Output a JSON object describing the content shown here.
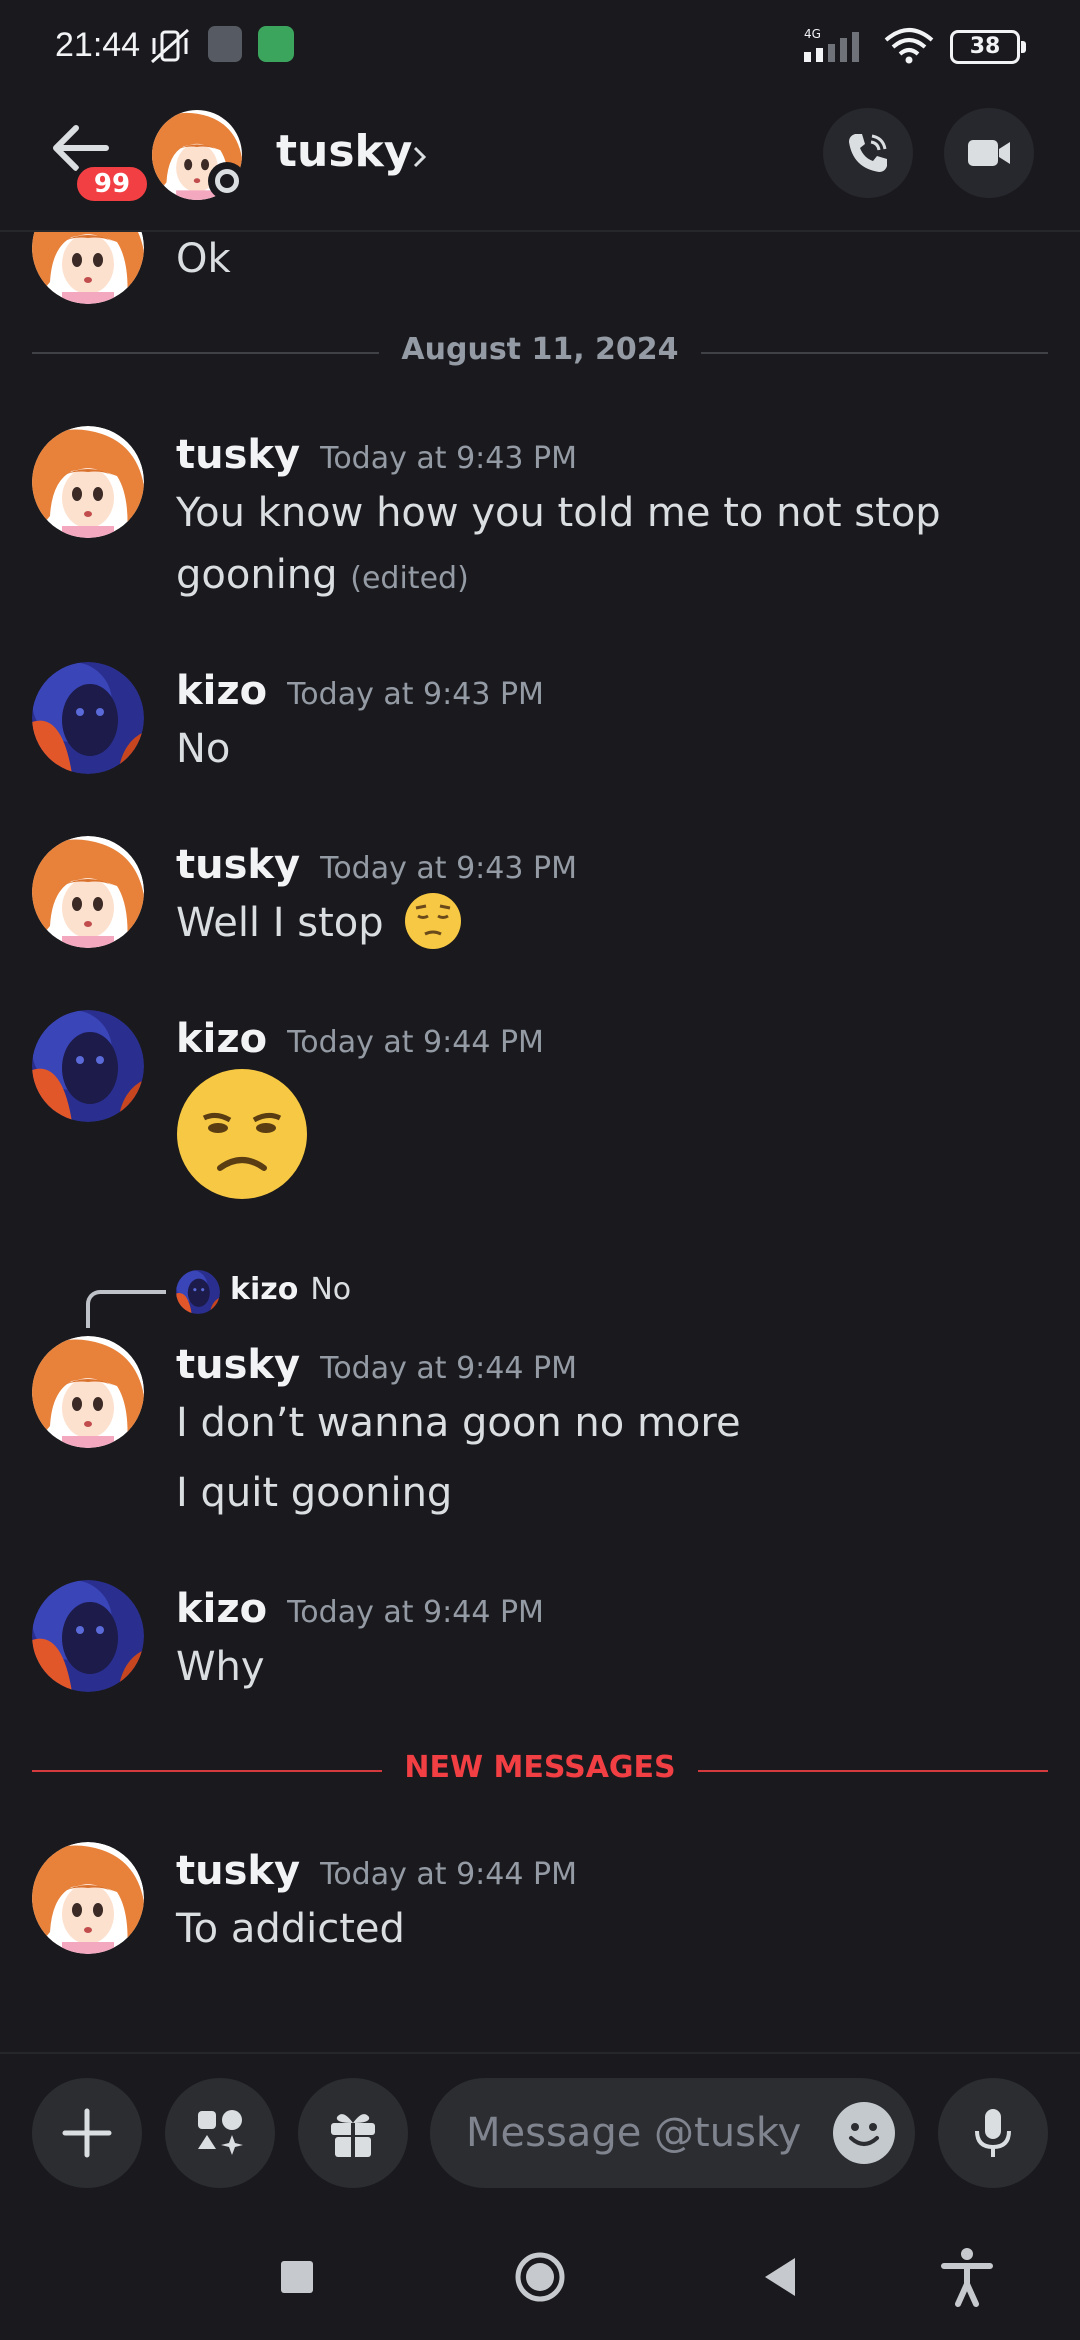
{
  "status_bar": {
    "time": "21:44",
    "network": "4G",
    "battery": "38"
  },
  "header": {
    "unread_badge": "99",
    "name": "tusky"
  },
  "divider_date": "August 11, 2024",
  "top_message": "Ok",
  "messages": [
    {
      "author": "tusky",
      "timestamp": "Today at 9:43 PM",
      "line1": "You know how you told me to not stop",
      "line2": "gooning",
      "edited": "(edited)"
    },
    {
      "author": "kizo",
      "timestamp": "Today at 9:43 PM",
      "text": "No"
    },
    {
      "author": "tusky",
      "timestamp": "Today at 9:43 PM",
      "text": "Well I stop",
      "emoji": "pensive-face"
    },
    {
      "author": "kizo",
      "timestamp": "Today at 9:44 PM",
      "emoji": "unamused-face"
    },
    {
      "author": "tusky",
      "timestamp": "Today at 9:44 PM",
      "line1": "I don’t wanna goon no more",
      "line2": "I quit gooning"
    },
    {
      "author": "kizo",
      "timestamp": "Today at 9:44 PM",
      "text": "Why"
    },
    {
      "author": "tusky",
      "timestamp": "Today at 9:44 PM",
      "text": "To addicted"
    }
  ],
  "reply": {
    "author": "kizo",
    "text": "No"
  },
  "new_messages_label": "NEW MESSAGES",
  "input": {
    "placeholder": "Message @tusky"
  },
  "colors": {
    "background": "#1a1a1e",
    "new_messages": "#f23f43",
    "badge": "#f23f43"
  },
  "icons": {
    "back": "arrow-left-icon",
    "call": "phone-icon",
    "video": "video-camera-icon",
    "plus": "plus-icon",
    "apps": "apps-icon",
    "gift": "gift-icon",
    "emoji": "smiley-icon",
    "mic": "microphone-icon"
  }
}
